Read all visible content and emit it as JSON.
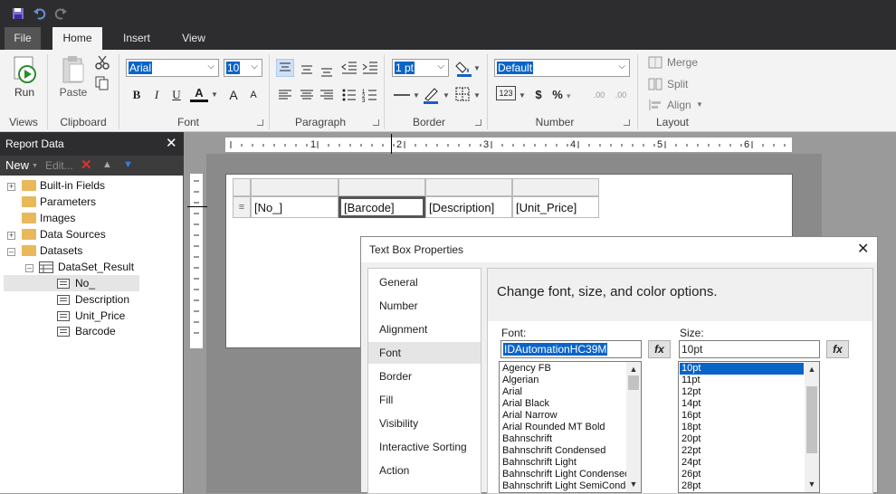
{
  "quick_access": {
    "save_icon": "save-icon",
    "undo_icon": "undo-icon",
    "redo_icon": "redo-icon"
  },
  "tabs": [
    {
      "label": "File"
    },
    {
      "label": "Home"
    },
    {
      "label": "Insert"
    },
    {
      "label": "View"
    }
  ],
  "ribbon": {
    "views": {
      "run_label": "Run",
      "group": "Views"
    },
    "clipboard": {
      "paste_label": "Paste",
      "group": "Clipboard"
    },
    "font": {
      "family": "Arial",
      "size": "10",
      "group": "Font",
      "bold": "B",
      "italic": "I",
      "underline": "U",
      "color": "A",
      "grow": "A",
      "shrink": "A"
    },
    "paragraph": {
      "group": "Paragraph"
    },
    "border": {
      "width": "1 pt",
      "group": "Border"
    },
    "number": {
      "format": "Default",
      "group": "Number",
      "placeholders": "123",
      "currency": "$",
      "percent": "%",
      "increase_dec": ".00",
      "decrease_dec": ".00"
    },
    "layout": {
      "merge": "Merge",
      "split": "Split",
      "align": "Align",
      "group": "Layout"
    }
  },
  "report_data": {
    "title": "Report Data",
    "new_label": "New",
    "edit_label": "Edit...",
    "tree": [
      {
        "label": "Built-in Fields"
      },
      {
        "label": "Parameters"
      },
      {
        "label": "Images"
      },
      {
        "label": "Data Sources"
      },
      {
        "label": "Datasets"
      },
      {
        "label": "DataSet_Result"
      },
      {
        "label": "No_"
      },
      {
        "label": "Description"
      },
      {
        "label": "Unit_Price"
      },
      {
        "label": "Barcode"
      }
    ]
  },
  "ruler": {
    "marks": [
      "1",
      "2",
      "3",
      "4",
      "5",
      "6"
    ]
  },
  "table": {
    "cells": [
      "[No_]",
      "[Barcode]",
      "[Description]",
      "[Unit_Price]"
    ]
  },
  "dialog": {
    "title": "Text Box Properties",
    "nav": [
      "General",
      "Number",
      "Alignment",
      "Font",
      "Border",
      "Fill",
      "Visibility",
      "Interactive Sorting",
      "Action"
    ],
    "selected_nav": "Font",
    "header": "Change font, size, and color options.",
    "font_label": "Font:",
    "font_value": "IDAutomationHC39M",
    "size_label": "Size:",
    "size_value": "10pt",
    "fx": "fx",
    "fonts": [
      "Agency FB",
      "Algerian",
      "Arial",
      "Arial Black",
      "Arial Narrow",
      "Arial Rounded MT Bold",
      "Bahnschrift",
      "Bahnschrift Condensed",
      "Bahnschrift Light",
      "Bahnschrift Light Condensed",
      "Bahnschrift Light SemiCondensed"
    ],
    "sizes": [
      "10pt",
      "11pt",
      "12pt",
      "14pt",
      "16pt",
      "18pt",
      "20pt",
      "22pt",
      "24pt",
      "26pt",
      "28pt"
    ]
  },
  "colors": {
    "accent": "#0a64c8",
    "chrome": "#2d2d30"
  }
}
